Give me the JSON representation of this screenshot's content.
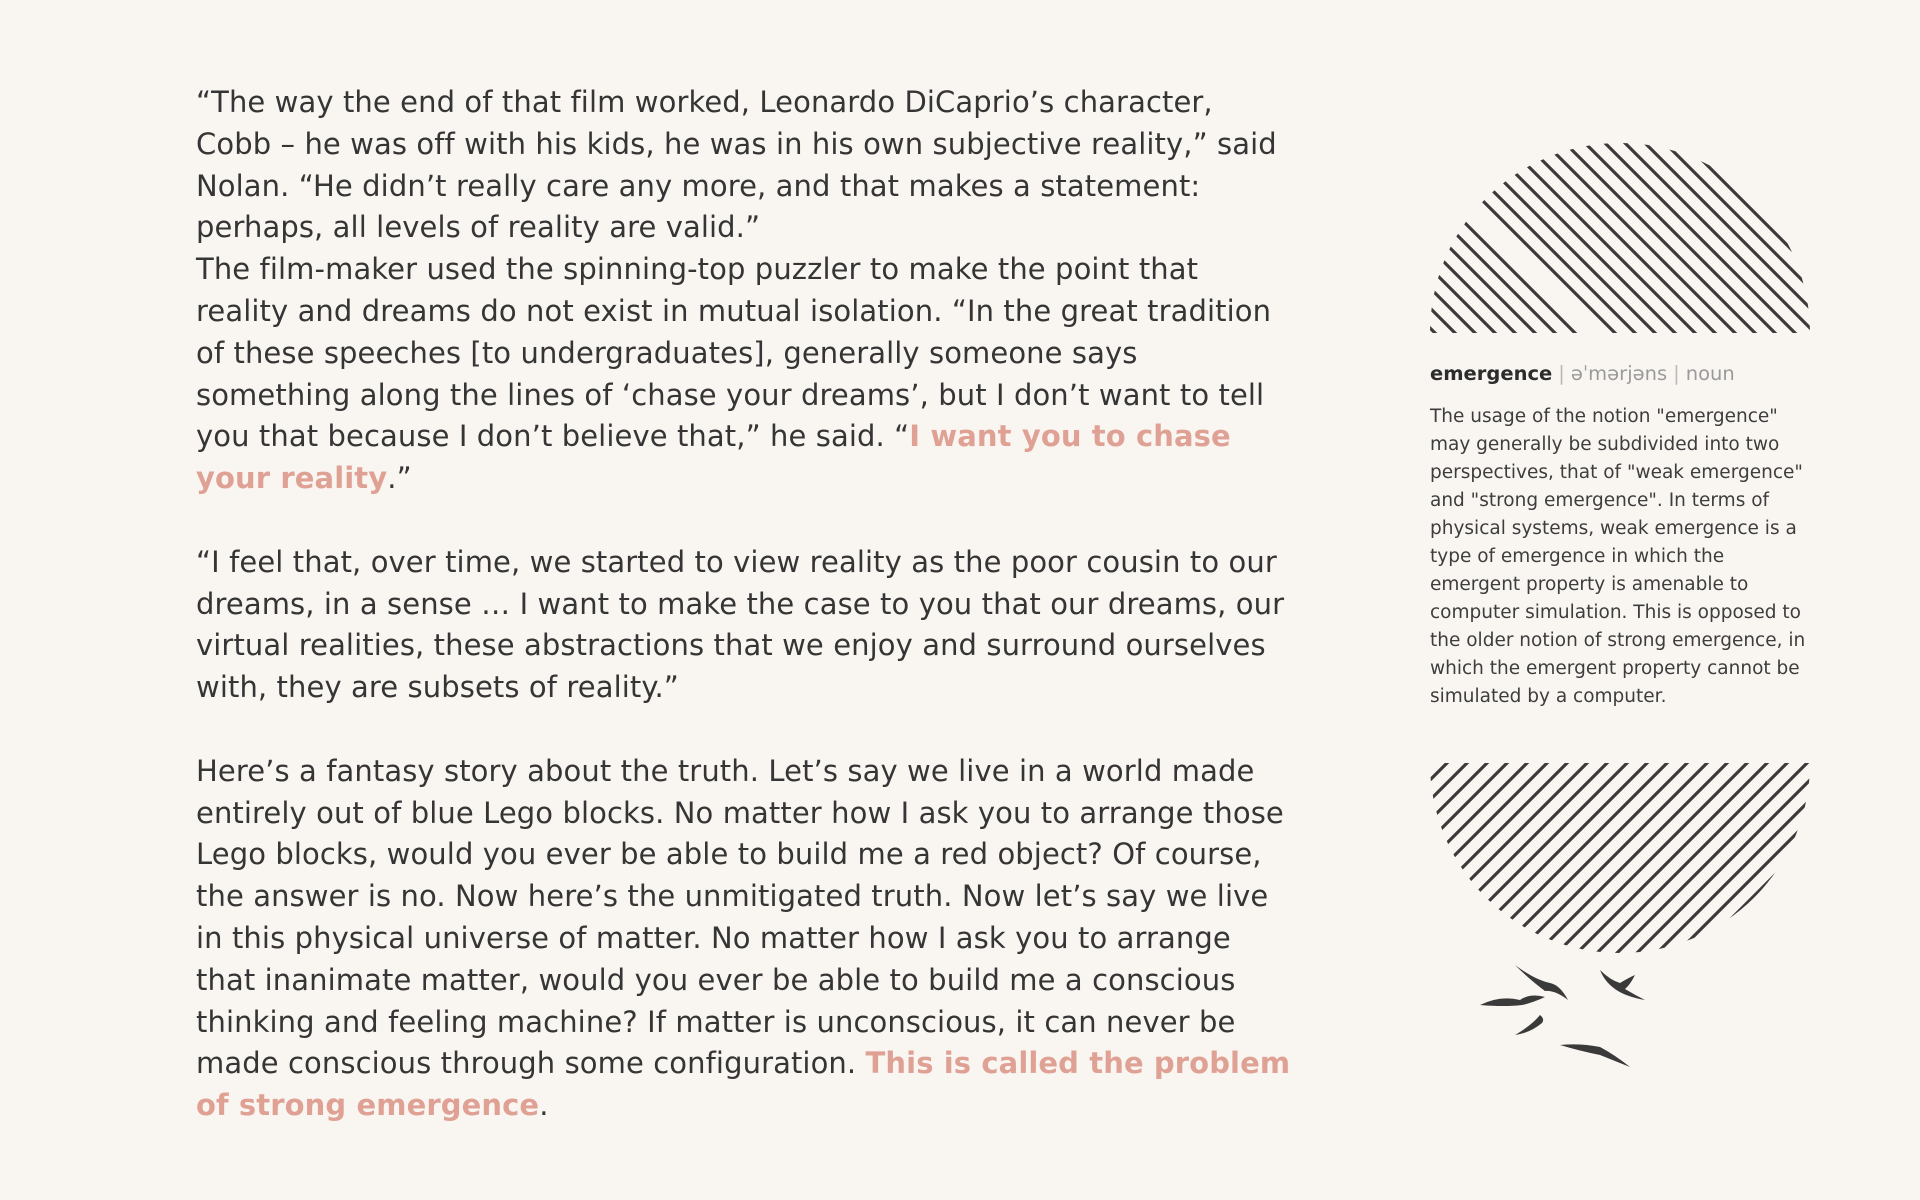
{
  "article": {
    "p1": "“The way the end of that film worked, Leonardo DiCaprio’s character, Cobb – he was off with his kids, he was in his own subjective reality,” said Nolan. “He didn’t really care any more, and that makes a statement: perhaps, all levels of reality are valid.”",
    "p2_start": "The film-maker used the spinning-top puzzler to make the point that reality and dreams do not exist in mutual isolation. “In the great tradition of these speeches [to undergraduates], generally someone says something along the lines of ‘chase your dreams’, but I don’t want to tell you that because I don’t believe that,” he said. “",
    "p2_highlight": "I want you to chase your reality",
    "p2_end": ".”",
    "p3": "“I feel that, over time, we started to view reality as the poor cousin to our dreams, in a sense … I want to make the case to you that our dreams, our virtual realities, these abstractions that we enjoy and surround ourselves with, they are subsets of reality.”",
    "p4_start": "Here’s a fantasy story about the truth. Let’s say we live in a world made entirely out of blue Lego blocks. No matter how I ask you to arrange those Lego blocks, would you ever be able to build me a red object? Of course, the answer is no. Now here’s the unmitigated truth. Now let’s say we live in this physical universe of matter. No matter how I ask you to arrange that inanimate matter, would you ever be able to build me a conscious thinking and feeling machine? If matter is unconscious, it can never be made conscious through some configuration. ",
    "p4_highlight": "This is called the problem of strong emergence",
    "p4_end": "."
  },
  "definition": {
    "term": "emergence",
    "separator": "|",
    "pronunciation": "əˈmərjəns",
    "part_of_speech": "noun",
    "text": "The usage of the notion \"emergence\" may generally be subdivided into two perspectives, that of \"weak emergence\" and \"strong emergence\". In terms of physical systems, weak emergence is a type of emergence in which the emergent property is amenable to computer simulation. This is opposed to the older notion of strong emergence, in which the emergent property cannot be simulated by a computer."
  },
  "colors": {
    "background": "#f9f6f2",
    "text": "#353535",
    "highlight": "#e0a195",
    "hatch": "#3a3a3a"
  },
  "icons": {
    "top_graphic": "hatched-semicircle-top",
    "bottom_graphic": "hatched-semicircle-bottom",
    "birds": "flying-birds-illustration"
  }
}
